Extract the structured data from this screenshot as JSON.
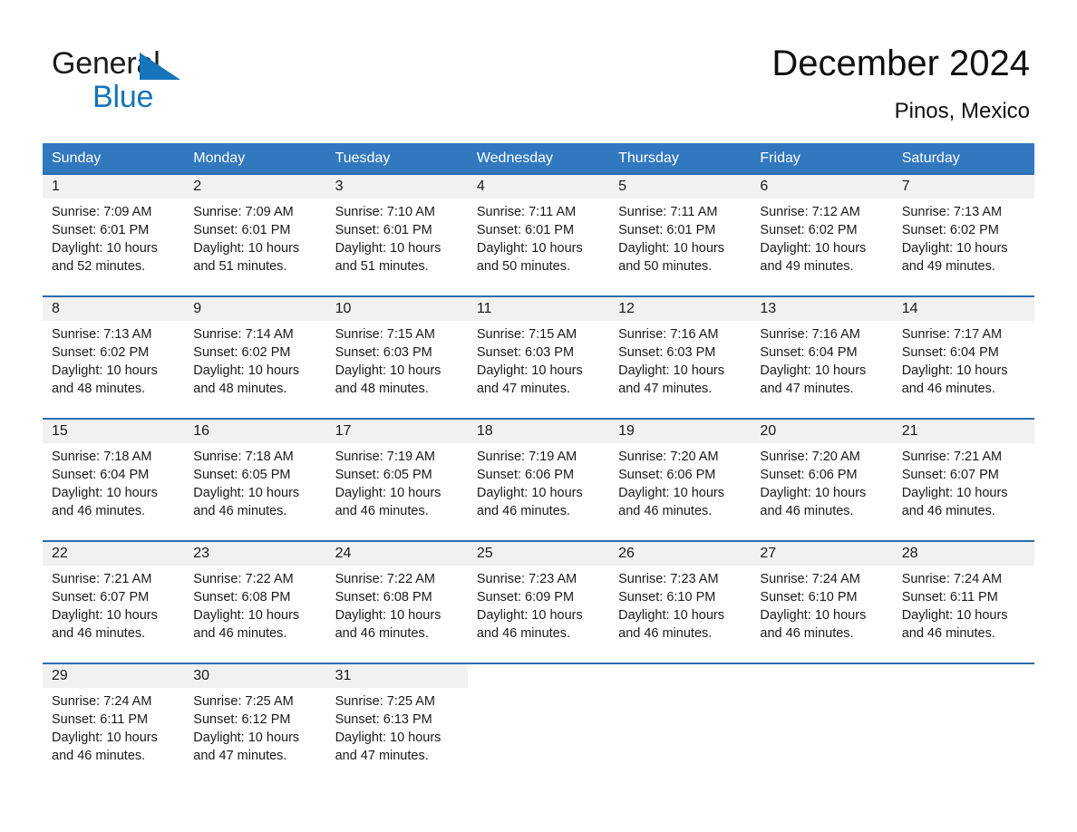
{
  "brand": {
    "word1": "General",
    "word2": "Blue",
    "triangle_color": "#1574bb"
  },
  "header": {
    "title": "December 2024",
    "subtitle": "Pinos, Mexico"
  },
  "colors": {
    "header_blue": "#3178be",
    "row_rule_blue": "#2c6cb0",
    "daynum_band": "#f1f1f1",
    "text": "#1a1a1a"
  },
  "weekday_headers": [
    "Sunday",
    "Monday",
    "Tuesday",
    "Wednesday",
    "Thursday",
    "Friday",
    "Saturday"
  ],
  "weeks": [
    [
      {
        "day": "1",
        "sunrise": "Sunrise: 7:09 AM",
        "sunset": "Sunset: 6:01 PM",
        "daylight1": "Daylight: 10 hours",
        "daylight2": "and 52 minutes."
      },
      {
        "day": "2",
        "sunrise": "Sunrise: 7:09 AM",
        "sunset": "Sunset: 6:01 PM",
        "daylight1": "Daylight: 10 hours",
        "daylight2": "and 51 minutes."
      },
      {
        "day": "3",
        "sunrise": "Sunrise: 7:10 AM",
        "sunset": "Sunset: 6:01 PM",
        "daylight1": "Daylight: 10 hours",
        "daylight2": "and 51 minutes."
      },
      {
        "day": "4",
        "sunrise": "Sunrise: 7:11 AM",
        "sunset": "Sunset: 6:01 PM",
        "daylight1": "Daylight: 10 hours",
        "daylight2": "and 50 minutes."
      },
      {
        "day": "5",
        "sunrise": "Sunrise: 7:11 AM",
        "sunset": "Sunset: 6:01 PM",
        "daylight1": "Daylight: 10 hours",
        "daylight2": "and 50 minutes."
      },
      {
        "day": "6",
        "sunrise": "Sunrise: 7:12 AM",
        "sunset": "Sunset: 6:02 PM",
        "daylight1": "Daylight: 10 hours",
        "daylight2": "and 49 minutes."
      },
      {
        "day": "7",
        "sunrise": "Sunrise: 7:13 AM",
        "sunset": "Sunset: 6:02 PM",
        "daylight1": "Daylight: 10 hours",
        "daylight2": "and 49 minutes."
      }
    ],
    [
      {
        "day": "8",
        "sunrise": "Sunrise: 7:13 AM",
        "sunset": "Sunset: 6:02 PM",
        "daylight1": "Daylight: 10 hours",
        "daylight2": "and 48 minutes."
      },
      {
        "day": "9",
        "sunrise": "Sunrise: 7:14 AM",
        "sunset": "Sunset: 6:02 PM",
        "daylight1": "Daylight: 10 hours",
        "daylight2": "and 48 minutes."
      },
      {
        "day": "10",
        "sunrise": "Sunrise: 7:15 AM",
        "sunset": "Sunset: 6:03 PM",
        "daylight1": "Daylight: 10 hours",
        "daylight2": "and 48 minutes."
      },
      {
        "day": "11",
        "sunrise": "Sunrise: 7:15 AM",
        "sunset": "Sunset: 6:03 PM",
        "daylight1": "Daylight: 10 hours",
        "daylight2": "and 47 minutes."
      },
      {
        "day": "12",
        "sunrise": "Sunrise: 7:16 AM",
        "sunset": "Sunset: 6:03 PM",
        "daylight1": "Daylight: 10 hours",
        "daylight2": "and 47 minutes."
      },
      {
        "day": "13",
        "sunrise": "Sunrise: 7:16 AM",
        "sunset": "Sunset: 6:04 PM",
        "daylight1": "Daylight: 10 hours",
        "daylight2": "and 47 minutes."
      },
      {
        "day": "14",
        "sunrise": "Sunrise: 7:17 AM",
        "sunset": "Sunset: 6:04 PM",
        "daylight1": "Daylight: 10 hours",
        "daylight2": "and 46 minutes."
      }
    ],
    [
      {
        "day": "15",
        "sunrise": "Sunrise: 7:18 AM",
        "sunset": "Sunset: 6:04 PM",
        "daylight1": "Daylight: 10 hours",
        "daylight2": "and 46 minutes."
      },
      {
        "day": "16",
        "sunrise": "Sunrise: 7:18 AM",
        "sunset": "Sunset: 6:05 PM",
        "daylight1": "Daylight: 10 hours",
        "daylight2": "and 46 minutes."
      },
      {
        "day": "17",
        "sunrise": "Sunrise: 7:19 AM",
        "sunset": "Sunset: 6:05 PM",
        "daylight1": "Daylight: 10 hours",
        "daylight2": "and 46 minutes."
      },
      {
        "day": "18",
        "sunrise": "Sunrise: 7:19 AM",
        "sunset": "Sunset: 6:06 PM",
        "daylight1": "Daylight: 10 hours",
        "daylight2": "and 46 minutes."
      },
      {
        "day": "19",
        "sunrise": "Sunrise: 7:20 AM",
        "sunset": "Sunset: 6:06 PM",
        "daylight1": "Daylight: 10 hours",
        "daylight2": "and 46 minutes."
      },
      {
        "day": "20",
        "sunrise": "Sunrise: 7:20 AM",
        "sunset": "Sunset: 6:06 PM",
        "daylight1": "Daylight: 10 hours",
        "daylight2": "and 46 minutes."
      },
      {
        "day": "21",
        "sunrise": "Sunrise: 7:21 AM",
        "sunset": "Sunset: 6:07 PM",
        "daylight1": "Daylight: 10 hours",
        "daylight2": "and 46 minutes."
      }
    ],
    [
      {
        "day": "22",
        "sunrise": "Sunrise: 7:21 AM",
        "sunset": "Sunset: 6:07 PM",
        "daylight1": "Daylight: 10 hours",
        "daylight2": "and 46 minutes."
      },
      {
        "day": "23",
        "sunrise": "Sunrise: 7:22 AM",
        "sunset": "Sunset: 6:08 PM",
        "daylight1": "Daylight: 10 hours",
        "daylight2": "and 46 minutes."
      },
      {
        "day": "24",
        "sunrise": "Sunrise: 7:22 AM",
        "sunset": "Sunset: 6:08 PM",
        "daylight1": "Daylight: 10 hours",
        "daylight2": "and 46 minutes."
      },
      {
        "day": "25",
        "sunrise": "Sunrise: 7:23 AM",
        "sunset": "Sunset: 6:09 PM",
        "daylight1": "Daylight: 10 hours",
        "daylight2": "and 46 minutes."
      },
      {
        "day": "26",
        "sunrise": "Sunrise: 7:23 AM",
        "sunset": "Sunset: 6:10 PM",
        "daylight1": "Daylight: 10 hours",
        "daylight2": "and 46 minutes."
      },
      {
        "day": "27",
        "sunrise": "Sunrise: 7:24 AM",
        "sunset": "Sunset: 6:10 PM",
        "daylight1": "Daylight: 10 hours",
        "daylight2": "and 46 minutes."
      },
      {
        "day": "28",
        "sunrise": "Sunrise: 7:24 AM",
        "sunset": "Sunset: 6:11 PM",
        "daylight1": "Daylight: 10 hours",
        "daylight2": "and 46 minutes."
      }
    ],
    [
      {
        "day": "29",
        "sunrise": "Sunrise: 7:24 AM",
        "sunset": "Sunset: 6:11 PM",
        "daylight1": "Daylight: 10 hours",
        "daylight2": "and 46 minutes."
      },
      {
        "day": "30",
        "sunrise": "Sunrise: 7:25 AM",
        "sunset": "Sunset: 6:12 PM",
        "daylight1": "Daylight: 10 hours",
        "daylight2": "and 47 minutes."
      },
      {
        "day": "31",
        "sunrise": "Sunrise: 7:25 AM",
        "sunset": "Sunset: 6:13 PM",
        "daylight1": "Daylight: 10 hours",
        "daylight2": "and 47 minutes."
      },
      {
        "day": "",
        "sunrise": "",
        "sunset": "",
        "daylight1": "",
        "daylight2": ""
      },
      {
        "day": "",
        "sunrise": "",
        "sunset": "",
        "daylight1": "",
        "daylight2": ""
      },
      {
        "day": "",
        "sunrise": "",
        "sunset": "",
        "daylight1": "",
        "daylight2": ""
      },
      {
        "day": "",
        "sunrise": "",
        "sunset": "",
        "daylight1": "",
        "daylight2": ""
      }
    ]
  ]
}
